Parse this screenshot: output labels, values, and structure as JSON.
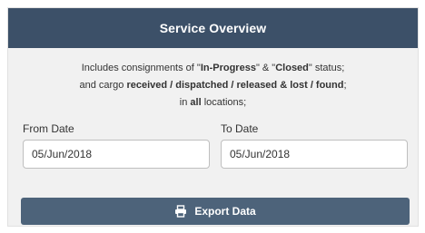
{
  "header": {
    "title": "Service Overview"
  },
  "description": {
    "line1": {
      "prefix": "Includes consignments of \"",
      "status1": "In-Progress",
      "middle": "\" & \"",
      "status2": "Closed",
      "suffix": "\" status;"
    },
    "line2": {
      "prefix": "and cargo ",
      "cargo_states": "received / dispatched / released & lost / found",
      "suffix": ";"
    },
    "line3": {
      "prefix": "in ",
      "scope": "all",
      "suffix": " locations;"
    }
  },
  "from_date": {
    "label": "From Date",
    "value": "05/Jun/2018"
  },
  "to_date": {
    "label": "To Date",
    "value": "05/Jun/2018"
  },
  "export_button": {
    "label": "Export Data",
    "icon": "printer-icon"
  },
  "colors": {
    "header_bg": "#3c5068",
    "button_bg": "#4d637a",
    "panel_bg": "#f1f1f1"
  }
}
